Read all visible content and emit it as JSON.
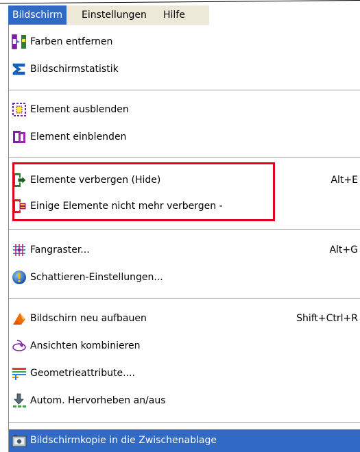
{
  "menubar": {
    "items": [
      {
        "label": "Bildschirm",
        "active": true
      },
      {
        "label": "Einstellungen",
        "active": false
      },
      {
        "label": "Hilfe",
        "active": false
      }
    ]
  },
  "menu": {
    "items": [
      {
        "label": "Farben entfernen",
        "icon": "color-split-icon",
        "shortcut": ""
      },
      {
        "label": "Bildschirmstatistik",
        "icon": "sigma-icon",
        "shortcut": ""
      },
      {
        "label": "Element ausblenden",
        "icon": "hide-element-icon",
        "shortcut": ""
      },
      {
        "label": "Element einblenden",
        "icon": "show-element-icon",
        "shortcut": ""
      },
      {
        "label": "Elemente verbergen (Hide)",
        "icon": "hide-elements-icon",
        "shortcut": "Alt+E"
      },
      {
        "label": "Einige Elemente nicht mehr verbergen -",
        "icon": "unhide-elements-icon",
        "shortcut": ""
      },
      {
        "label": "Fangraster...",
        "icon": "snap-grid-icon",
        "shortcut": "Alt+G"
      },
      {
        "label": "Schattieren-Einstellungen...",
        "icon": "shading-icon",
        "shortcut": ""
      },
      {
        "label": "Bildschirn neu aufbauen",
        "icon": "redraw-icon",
        "shortcut": "Shift+Ctrl+R"
      },
      {
        "label": "Ansichten kombinieren",
        "icon": "combine-views-icon",
        "shortcut": ""
      },
      {
        "label": "Geometrieattribute....",
        "icon": "geometry-attributes-icon",
        "shortcut": ""
      },
      {
        "label": "Autom. Hervorheben an/aus",
        "icon": "auto-highlight-icon",
        "shortcut": ""
      },
      {
        "label": "Bildschirmkopie in die Zwischenablage",
        "icon": "screen-copy-icon",
        "shortcut": "",
        "selected": true
      }
    ]
  },
  "colors": {
    "selection": "#316ac5",
    "highlight_border": "#e3001b",
    "menubar_bg": "#ece9d8"
  }
}
